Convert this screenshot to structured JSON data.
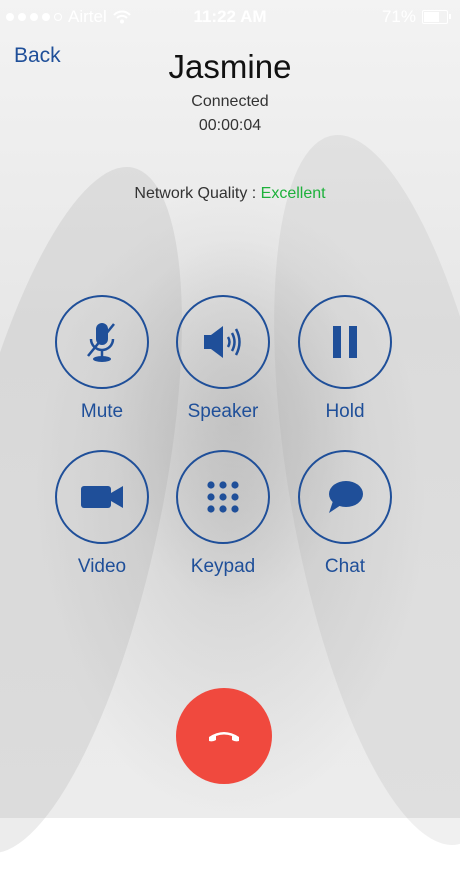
{
  "status_bar": {
    "carrier": "Airtel",
    "time": "11:22 AM",
    "battery": "71%"
  },
  "nav": {
    "back_label": "Back"
  },
  "call": {
    "name": "Jasmine",
    "state": "Connected",
    "duration": "00:00:04",
    "network_quality_label": "Network Quality :",
    "network_quality_value": "Excellent"
  },
  "controls": {
    "mute": "Mute",
    "speaker": "Speaker",
    "hold": "Hold",
    "video": "Video",
    "keypad": "Keypad",
    "chat": "Chat"
  },
  "colors": {
    "accent": "#1f4f99",
    "quality_good": "#1db13b",
    "end_call": "#f0493e"
  }
}
